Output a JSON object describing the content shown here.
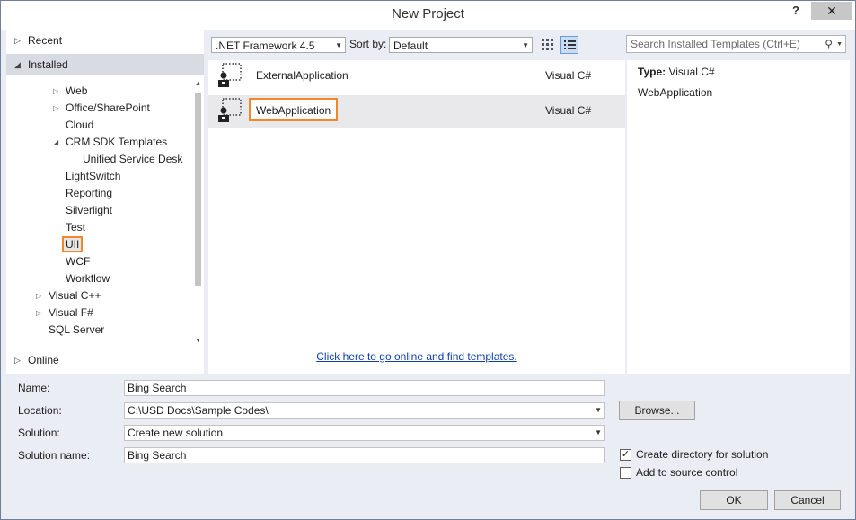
{
  "window": {
    "title": "New Project",
    "help": "?",
    "close": "✕"
  },
  "left": {
    "recent": "Recent",
    "installed": "Installed",
    "online": "Online",
    "tree": {
      "web": "Web",
      "office": "Office/SharePoint",
      "cloud": "Cloud",
      "crm": "CRM SDK Templates",
      "usd": "Unified Service Desk",
      "lightswitch": "LightSwitch",
      "reporting": "Reporting",
      "silverlight": "Silverlight",
      "test": "Test",
      "uii": "UII",
      "wcf": "WCF",
      "workflow": "Workflow",
      "vcpp": "Visual C++",
      "vfsharp": "Visual F#",
      "sqlserver": "SQL Server"
    }
  },
  "toolbar": {
    "framework": ".NET Framework 4.5",
    "sort_label": "Sort by:",
    "sort_value": "Default",
    "search_placeholder": "Search Installed Templates (Ctrl+E)"
  },
  "templates": [
    {
      "name": "ExternalApplication",
      "lang": "Visual C#"
    },
    {
      "name": "WebApplication",
      "lang": "Visual C#"
    }
  ],
  "online_link": "Click here to go online and find templates.",
  "info": {
    "type_label": "Type:",
    "type_value": "Visual C#",
    "description": "WebApplication"
  },
  "form": {
    "name_label": "Name:",
    "name_value": "Bing Search",
    "location_label": "Location:",
    "location_value": "C:\\USD Docs\\Sample Codes\\",
    "solution_label": "Solution:",
    "solution_value": "Create new solution",
    "solution_name_label": "Solution name:",
    "solution_name_value": "Bing Search",
    "browse": "Browse...",
    "create_dir": "Create directory for solution",
    "add_source": "Add to source control",
    "ok": "OK",
    "cancel": "Cancel"
  },
  "colors": {
    "highlight": "#f0872a",
    "link": "#0e3fa9",
    "background": "#ebedf4"
  }
}
